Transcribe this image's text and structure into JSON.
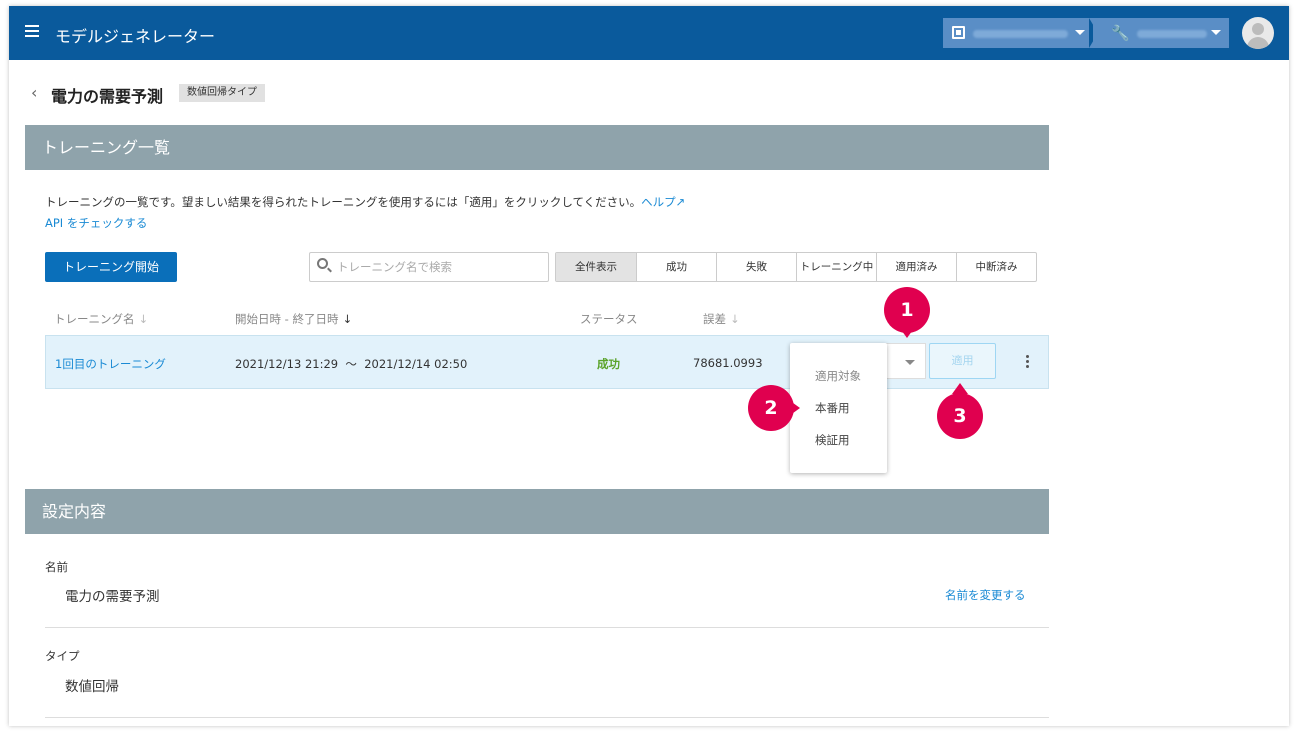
{
  "app": {
    "title": "モデルジェネレーター"
  },
  "header": {
    "org_icon": "building-icon",
    "project_icon": "wrench-icon"
  },
  "page": {
    "back_icon": "chevron-left-icon",
    "title": "電力の需要予測",
    "type_badge": "数値回帰タイプ"
  },
  "training": {
    "section_title": "トレーニング一覧",
    "description": "トレーニングの一覧です。望ましい結果を得られたトレーニングを使用するには「適用」をクリックしてください。",
    "help_link": "ヘルプ",
    "api_link": "API をチェックする",
    "start_button": "トレーニング開始",
    "search_placeholder": "トレーニング名で検索",
    "filters": [
      "全件表示",
      "成功",
      "失敗",
      "トレーニング中",
      "適用済み",
      "中断済み"
    ],
    "columns": {
      "name": "トレーニング名",
      "dates": "開始日時 - 終了日時",
      "status": "ステータス",
      "error": "誤差"
    },
    "rows": [
      {
        "name": "1回目のトレーニング",
        "start": "2021/12/13 21:29",
        "sep": "〜",
        "end": "2021/12/14 02:50",
        "status": "成功",
        "error": "78681.0993",
        "apply": "適用"
      }
    ],
    "dropdown": {
      "header": "適用対象",
      "options": [
        "本番用",
        "検証用"
      ]
    },
    "markers": [
      "1",
      "2",
      "3"
    ]
  },
  "settings": {
    "section_title": "設定内容",
    "name_label": "名前",
    "name_value": "電力の需要予測",
    "rename_link": "名前を変更する",
    "type_label": "タイプ",
    "type_value": "数値回帰"
  },
  "colors": {
    "topbar": "#0a5a9c",
    "section_header": "#8fa3ab",
    "primary_button": "#0a6fba",
    "link": "#1a8ad4",
    "success": "#5aa32a",
    "marker": "#e0004f",
    "row_highlight": "#e2f2fb"
  }
}
